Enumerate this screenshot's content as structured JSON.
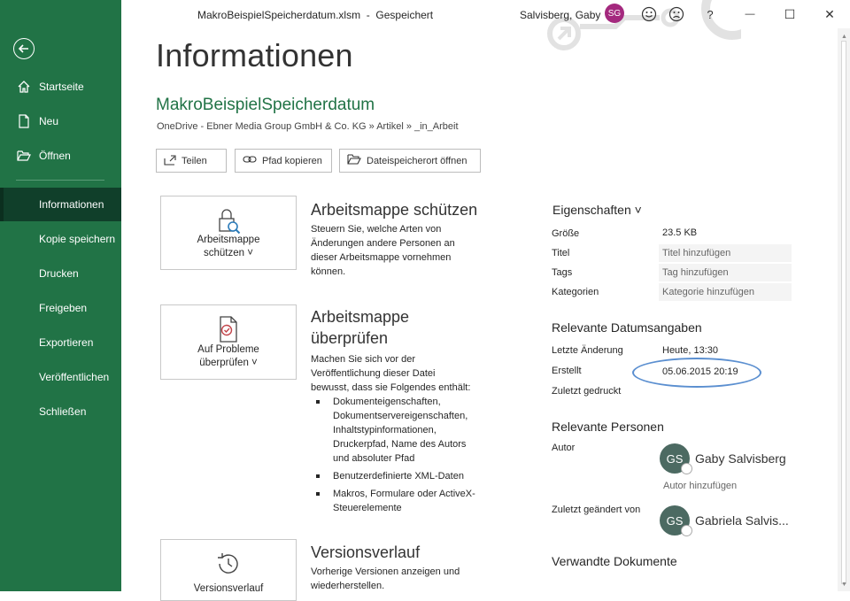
{
  "titlebar": {
    "filename": "MakroBeispielSpeicherdatum.xlsm",
    "separator": "-",
    "save_status": "Gespeichert",
    "user_name": "Salvisberg, Gaby",
    "user_initials": "SG",
    "smile_icon": "smiley-face-icon",
    "frown_icon": "frown-face-icon",
    "help": "?",
    "minimize": "—",
    "restore": "☐",
    "close": "✕"
  },
  "sidebar": {
    "items": [
      {
        "label": "Startseite",
        "icon": "home-icon"
      },
      {
        "label": "Neu",
        "icon": "new-document-icon"
      },
      {
        "label": "Öffnen",
        "icon": "folder-open-icon"
      },
      {
        "label": "Informationen"
      },
      {
        "label": "Kopie speichern"
      },
      {
        "label": "Drucken"
      },
      {
        "label": "Freigeben"
      },
      {
        "label": "Exportieren"
      },
      {
        "label": "Veröffentlichen"
      },
      {
        "label": "Schließen"
      }
    ],
    "active": "Informationen"
  },
  "main": {
    "heading": "Informationen",
    "doc_name": "MakroBeispielSpeicherdatum",
    "doc_path": "OneDrive - Ebner Media Group GmbH & Co. KG » Artikel » _in_Arbeit",
    "buttons": {
      "share": "Teilen",
      "copy_path": "Pfad kopieren",
      "open_location": "Dateispeicherort öffnen"
    },
    "protect": {
      "card_line1": "Arbeitsmappe",
      "card_line2": "schützen ˅",
      "title": "Arbeitsmappe schützen",
      "desc": "Steuern Sie, welche Arten von Änderungen andere Personen an dieser Arbeitsmappe vornehmen können."
    },
    "inspect": {
      "card_line1": "Auf Probleme",
      "card_line2": "überprüfen ˅",
      "title": "Arbeitsmappe überprüfen",
      "desc": "Machen Sie sich vor der Veröffentlichung dieser Datei bewusst, dass sie Folgendes enthält:",
      "bullets": [
        "Dokumenteigenschaften, Dokumentservereigenschaften, Inhaltstypinformationen, Druckerpfad, Name des Autors und absoluter Pfad",
        "Benutzerdefinierte XML-Daten",
        "Makros, Formulare oder ActiveX-Steuerelemente"
      ]
    },
    "versions": {
      "card_label": "Versionsverlauf",
      "title": "Versionsverlauf",
      "desc": "Vorherige Versionen anzeigen und wiederherstellen."
    }
  },
  "properties": {
    "heading": "Eigenschaften ˅",
    "rows": [
      {
        "label": "Größe",
        "value": "23.5 KB"
      },
      {
        "label": "Titel",
        "value": "Titel hinzufügen"
      },
      {
        "label": "Tags",
        "value": "Tag hinzufügen"
      },
      {
        "label": "Kategorien",
        "value": "Kategorie hinzufügen"
      }
    ],
    "dates_heading": "Relevante Datumsangaben",
    "dates": [
      {
        "label": "Letzte Änderung",
        "value": "Heute, 13:30"
      },
      {
        "label": "Erstellt",
        "value": "05.06.2015 20:19"
      },
      {
        "label": "Zuletzt gedruckt",
        "value": ""
      }
    ],
    "people_heading": "Relevante Personen",
    "author_label": "Autor",
    "author": {
      "initials": "GS",
      "name": "Gaby Salvisberg"
    },
    "add_author": "Autor hinzufügen",
    "modified_label": "Zuletzt geändert von",
    "modified_by": {
      "initials": "GS",
      "name": "Gabriela Salvis..."
    },
    "related_heading": "Verwandte Dokumente"
  },
  "colors": {
    "sidebar": "#217346",
    "active": "#103f2a",
    "accent": "#217346",
    "highlight_ellipse": "#5b8fd0"
  }
}
